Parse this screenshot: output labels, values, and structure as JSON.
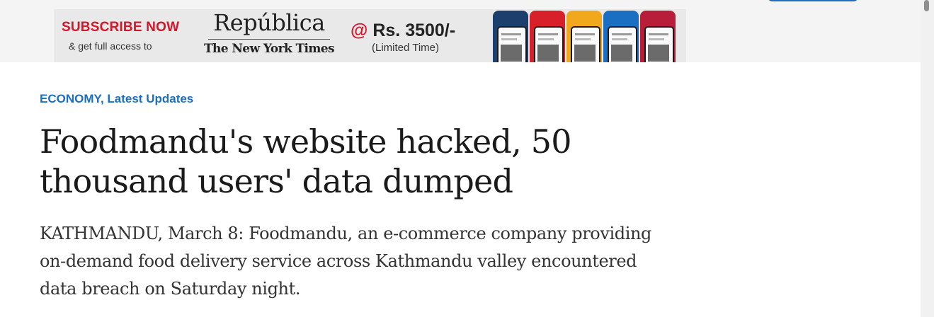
{
  "ad_banner": {
    "subscribe_label": "SUBSCRIBE NOW",
    "access_text": "& get full access to",
    "republica_logo": "República",
    "nyt_logo": "The New York Times",
    "price_at": "@",
    "price": "Rs. 3500/-",
    "limited_time": "(Limited Time)",
    "phone_colors": [
      "#1d3f6e",
      "#d8202b",
      "#f2a81d",
      "#1b6fc2",
      "#b81d3a"
    ]
  },
  "article": {
    "categories": "ECONOMY, Latest Updates",
    "headline": "Foodmandu's website hacked, 50 thousand users' data dumped",
    "summary": "KATHMANDU, March 8: Foodmandu, an e-commerce company providing on-demand food delivery service across Kathmandu valley encountered data breach on Saturday night."
  },
  "colors": {
    "accent_blue": "#1b6fc2",
    "brand_red": "#d6152a"
  }
}
